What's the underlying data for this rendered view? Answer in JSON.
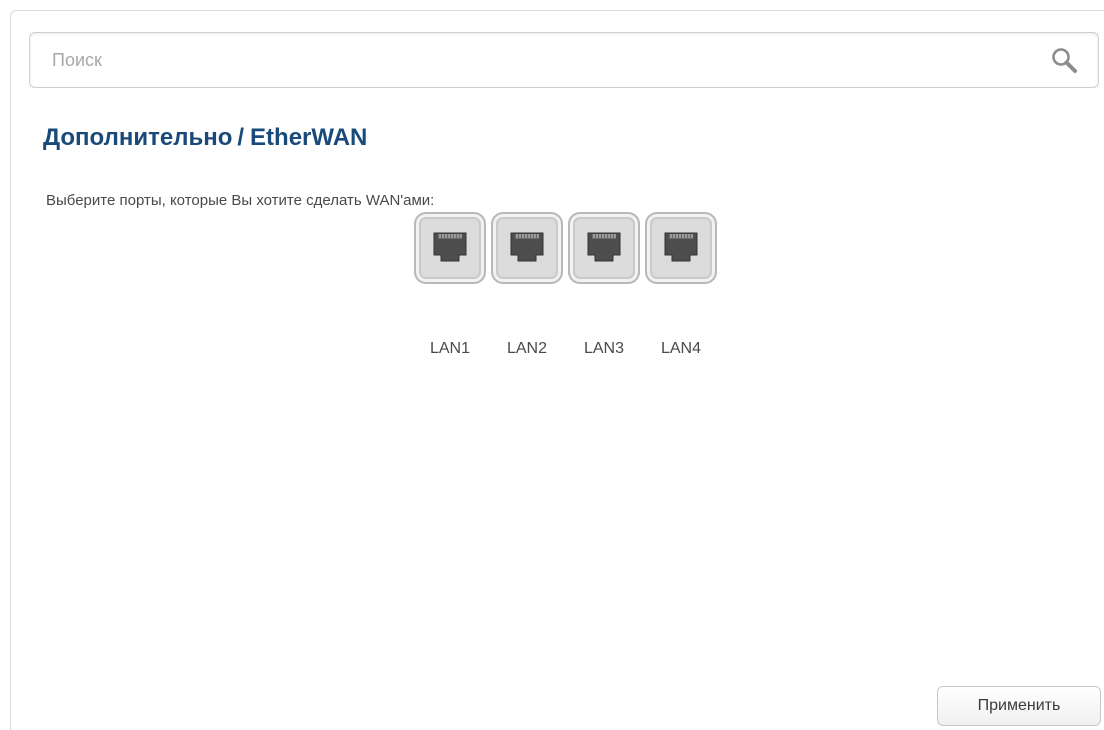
{
  "search": {
    "placeholder": "Поиск",
    "value": "",
    "icon": "search-icon"
  },
  "breadcrumb": {
    "section": "Дополнительно",
    "separator": "/",
    "page": "EtherWAN"
  },
  "instruction": "Выберите порты, которые Вы хотите сделать WAN'ами:",
  "ports": [
    {
      "label": "LAN1",
      "selected": false
    },
    {
      "label": "LAN2",
      "selected": false
    },
    {
      "label": "LAN3",
      "selected": false
    },
    {
      "label": "LAN4",
      "selected": false
    }
  ],
  "actions": {
    "apply_label": "Применить"
  },
  "colors": {
    "title": "#1a4a7a",
    "text": "#4a4a4a",
    "port_tile": "#dcdcdc",
    "port_socket": "#4d4d4d"
  }
}
